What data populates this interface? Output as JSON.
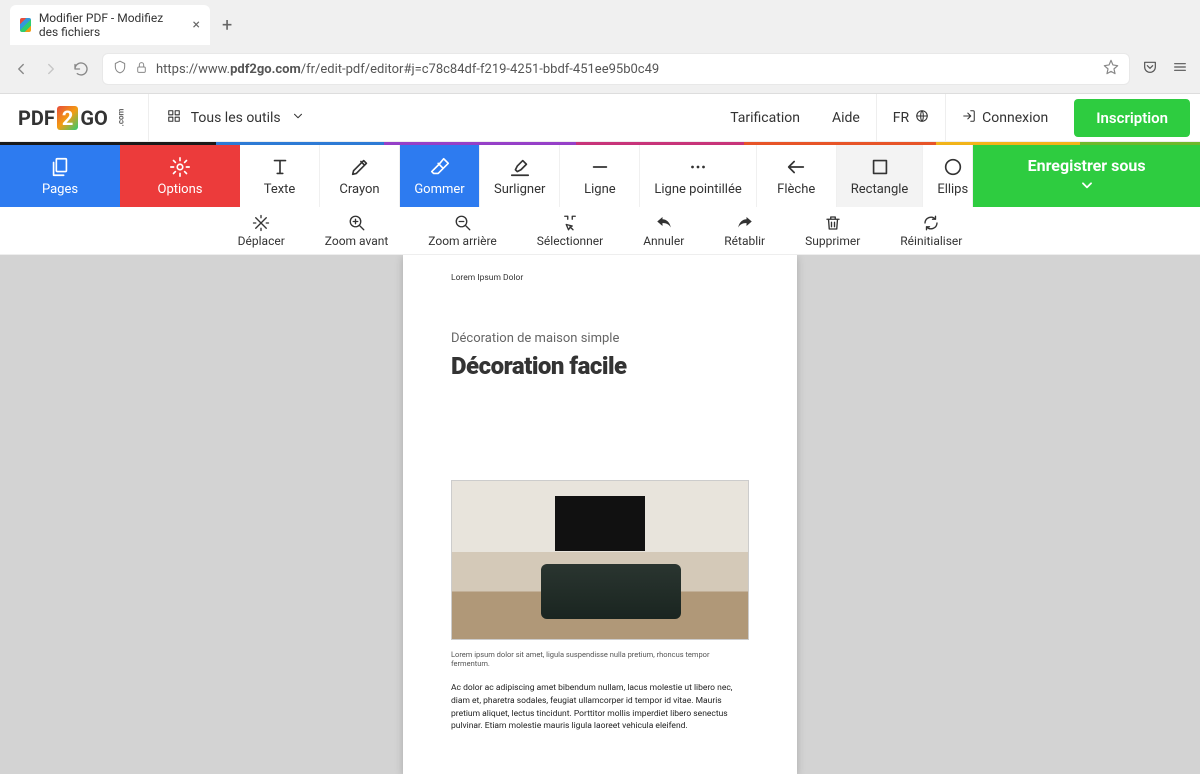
{
  "browser": {
    "tab_title": "Modifier PDF - Modifiez des fichiers",
    "url_prefix": "https://www.",
    "url_domain": "pdf2go.com",
    "url_path": "/fr/edit-pdf/editor#j=c78c84df-f219-4251-bbdf-451ee95b0c49"
  },
  "header": {
    "logo_pdf": "PDF",
    "logo_two": "2",
    "logo_go": "GO",
    "logo_com": ".com",
    "all_tools": "Tous les outils",
    "tarification": "Tarification",
    "aide": "Aide",
    "lang": "FR",
    "connexion": "Connexion",
    "inscription": "Inscription"
  },
  "toolbar": {
    "pages": "Pages",
    "options": "Options",
    "texte": "Texte",
    "crayon": "Crayon",
    "gommer": "Gommer",
    "surligner": "Surligner",
    "ligne": "Ligne",
    "ligne_pointillee": "Ligne pointillée",
    "fleche": "Flèche",
    "rectangle": "Rectangle",
    "ellipse": "Ellips",
    "save": "Enregistrer sous"
  },
  "sub": {
    "deplacer": "Déplacer",
    "zoom_avant": "Zoom avant",
    "zoom_arriere": "Zoom arrière",
    "selectionner": "Sélectionner",
    "annuler": "Annuler",
    "retablir": "Rétablir",
    "supprimer": "Supprimer",
    "reinitialiser": "Réinitialiser"
  },
  "doc": {
    "header_small": "Lorem Ipsum Dolor",
    "kicker": "Décoration de maison simple",
    "title": "Décoration facile",
    "caption": "Lorem ipsum dolor sit amet, ligula suspendisse nulla pretium, rhoncus tempor fermentum.",
    "body": "Ac dolor ac adipiscing amet bibendum nullam, lacus molestie ut libero nec, diam et, pharetra sodales, feugiat ullamcorper id tempor id vitae. Mauris pretium aliquet, lectus tincidunt. Porttitor mollis imperdiet libero senectus pulvinar. Etiam molestie mauris ligula laoreet vehicula eleifend."
  }
}
